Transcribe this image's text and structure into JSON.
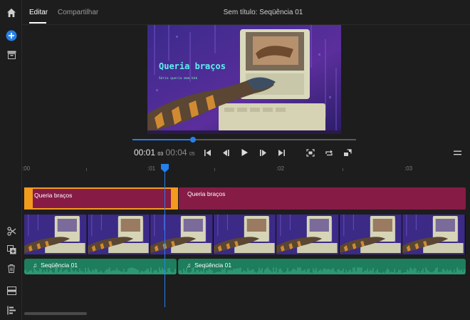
{
  "header": {
    "tabs": [
      {
        "label": "Editar",
        "active": true
      },
      {
        "label": "Compartilhar",
        "active": false
      }
    ],
    "sequence_title": "Sem título: Seqüência 01"
  },
  "rail": {
    "icons": [
      "home-icon",
      "add-media-icon",
      "media-bin-icon",
      "split-scissors-icon",
      "duplicate-icon",
      "trash-icon",
      "track-settings-icon",
      "align-icon"
    ]
  },
  "preview": {
    "overlay_title": "Queria braços",
    "overlay_subtitle": "Sério queria mem kkk"
  },
  "playback": {
    "current_time": "00:01",
    "current_frames": "03",
    "total_time": "00:04",
    "total_frames": "05",
    "progress_fraction": 0.27
  },
  "ruler": {
    "labels": [
      ":00",
      ":01",
      ":02",
      ":03"
    ]
  },
  "tracks": {
    "title_clips": [
      {
        "label": "Queria braços",
        "selected": true
      },
      {
        "label": "Queria braços",
        "selected": false
      }
    ],
    "audio_clips": [
      {
        "label": "Seqüência 01"
      },
      {
        "label": "Seqüência 01"
      }
    ]
  },
  "colors": {
    "accent": "#2680eb",
    "title_clip": "#861b46",
    "selection": "#f29b1c",
    "audio_clip": "#1d7d5c"
  }
}
